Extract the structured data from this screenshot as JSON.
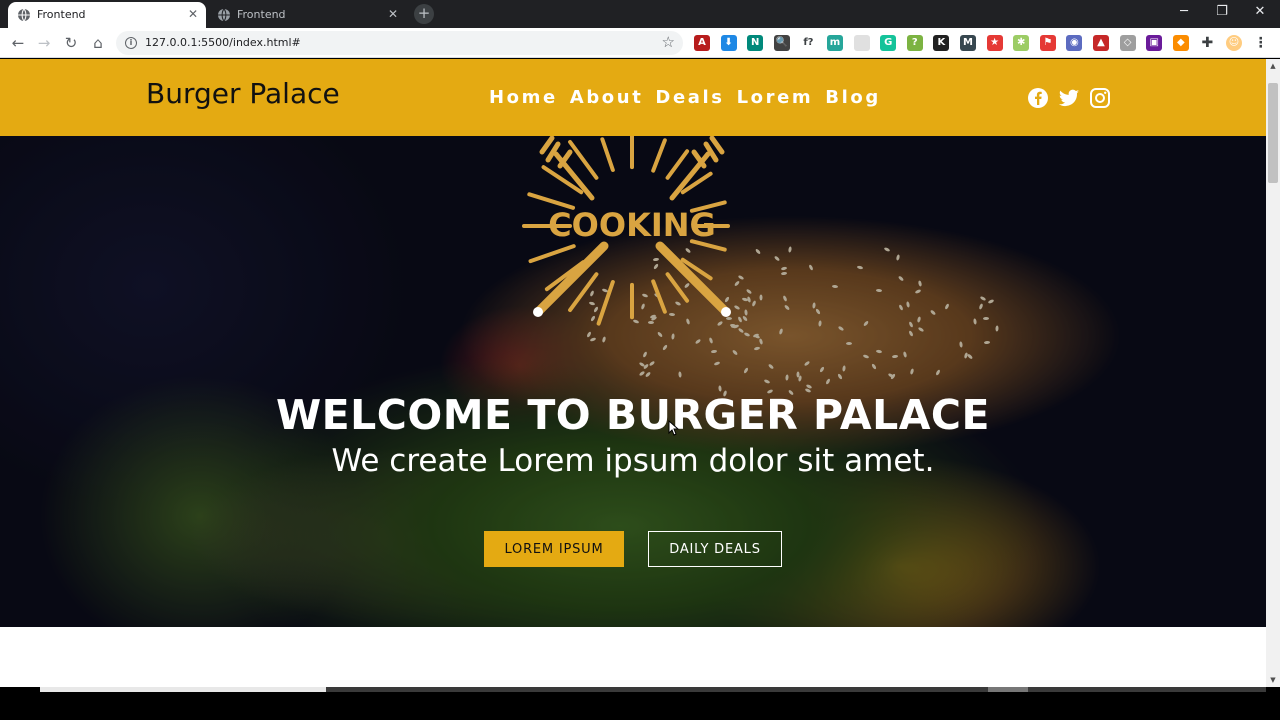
{
  "browser": {
    "tabs": [
      {
        "title": "Frontend",
        "active": true
      },
      {
        "title": "Frontend",
        "active": false
      }
    ],
    "new_tab": "+",
    "window_controls": {
      "minimize": "─",
      "maximize": "❐",
      "close": "✕"
    },
    "nav": {
      "back": "←",
      "forward": "→",
      "reload": "↻",
      "home": "⌂"
    },
    "url": "127.0.0.1:5500/index.html#",
    "extensions": [
      {
        "icon": "pdf-extension-icon",
        "color": "#b71c1c",
        "glyph": "A"
      },
      {
        "icon": "download-extension-icon",
        "color": "#1e88e5",
        "glyph": "⬇"
      },
      {
        "icon": "n-extension-icon",
        "color": "#00897b",
        "glyph": "N"
      },
      {
        "icon": "search-extension-icon",
        "color": "#424242",
        "glyph": "🔍"
      },
      {
        "icon": "formula-extension-icon",
        "color": "#ffffff",
        "glyph": "f?"
      },
      {
        "icon": "m-extension-icon",
        "color": "#26a69a",
        "glyph": "m"
      },
      {
        "icon": "blank-extension-icon",
        "color": "#e0e0e0",
        "glyph": ""
      },
      {
        "icon": "grammarly-extension-icon",
        "color": "#15c39a",
        "glyph": "G"
      },
      {
        "icon": "help-extension-icon",
        "color": "#7cb342",
        "glyph": "?"
      },
      {
        "icon": "k-extension-icon",
        "color": "#212121",
        "glyph": "K"
      },
      {
        "icon": "mail-extension-icon",
        "color": "#37474f",
        "glyph": "M"
      },
      {
        "icon": "star-extension-icon",
        "color": "#e53935",
        "glyph": "★"
      },
      {
        "icon": "puzzle-green-extension-icon",
        "color": "#9ccc65",
        "glyph": "✱"
      },
      {
        "icon": "flag-extension-icon",
        "color": "#e53935",
        "glyph": "⚑"
      },
      {
        "icon": "camera-extension-icon",
        "color": "#5c6bc0",
        "glyph": "◉"
      },
      {
        "icon": "chart-extension-icon",
        "color": "#c62828",
        "glyph": "▲"
      },
      {
        "icon": "tag-extension-icon",
        "color": "#9e9e9e",
        "glyph": "◇"
      },
      {
        "icon": "box-extension-icon",
        "color": "#6a1b9a",
        "glyph": "▣"
      },
      {
        "icon": "orange-extension-icon",
        "color": "#fb8c00",
        "glyph": "◆"
      },
      {
        "icon": "extensions-puzzle-icon",
        "color": "#5f6368",
        "glyph": "✚"
      },
      {
        "icon": "profile-avatar-icon",
        "color": "#ffcc80",
        "glyph": "☺"
      },
      {
        "icon": "menu-kebab-icon",
        "color": "#5f6368",
        "glyph": "⋮"
      }
    ]
  },
  "site": {
    "brand": "Burger Palace",
    "nav": [
      "Home",
      "About",
      "Deals",
      "Lorem",
      "Blog"
    ],
    "social": [
      "facebook-icon",
      "twitter-icon",
      "instagram-icon"
    ],
    "logo_text": "COOKING",
    "hero": {
      "title": "WELCOME TO BURGER PALACE",
      "subtitle": "We create Lorem ipsum dolor sit amet.",
      "primary_button": "LOREM IPSUM",
      "secondary_button": "DAILY DEALS"
    }
  },
  "colors": {
    "accent": "#e4aa12",
    "logo": "#d9a441",
    "chrome_dark": "#202124"
  }
}
